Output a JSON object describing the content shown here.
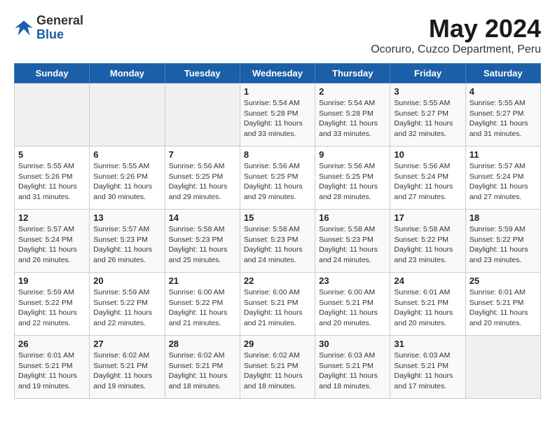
{
  "header": {
    "logo_general": "General",
    "logo_blue": "Blue",
    "title": "May 2024",
    "subtitle": "Ocoruro, Cuzco Department, Peru"
  },
  "days_of_week": [
    "Sunday",
    "Monday",
    "Tuesday",
    "Wednesday",
    "Thursday",
    "Friday",
    "Saturday"
  ],
  "weeks": [
    [
      {
        "day": "",
        "info": ""
      },
      {
        "day": "",
        "info": ""
      },
      {
        "day": "",
        "info": ""
      },
      {
        "day": "1",
        "info": "Sunrise: 5:54 AM\nSunset: 5:28 PM\nDaylight: 11 hours\nand 33 minutes."
      },
      {
        "day": "2",
        "info": "Sunrise: 5:54 AM\nSunset: 5:28 PM\nDaylight: 11 hours\nand 33 minutes."
      },
      {
        "day": "3",
        "info": "Sunrise: 5:55 AM\nSunset: 5:27 PM\nDaylight: 11 hours\nand 32 minutes."
      },
      {
        "day": "4",
        "info": "Sunrise: 5:55 AM\nSunset: 5:27 PM\nDaylight: 11 hours\nand 31 minutes."
      }
    ],
    [
      {
        "day": "5",
        "info": "Sunrise: 5:55 AM\nSunset: 5:26 PM\nDaylight: 11 hours\nand 31 minutes."
      },
      {
        "day": "6",
        "info": "Sunrise: 5:55 AM\nSunset: 5:26 PM\nDaylight: 11 hours\nand 30 minutes."
      },
      {
        "day": "7",
        "info": "Sunrise: 5:56 AM\nSunset: 5:25 PM\nDaylight: 11 hours\nand 29 minutes."
      },
      {
        "day": "8",
        "info": "Sunrise: 5:56 AM\nSunset: 5:25 PM\nDaylight: 11 hours\nand 29 minutes."
      },
      {
        "day": "9",
        "info": "Sunrise: 5:56 AM\nSunset: 5:25 PM\nDaylight: 11 hours\nand 28 minutes."
      },
      {
        "day": "10",
        "info": "Sunrise: 5:56 AM\nSunset: 5:24 PM\nDaylight: 11 hours\nand 27 minutes."
      },
      {
        "day": "11",
        "info": "Sunrise: 5:57 AM\nSunset: 5:24 PM\nDaylight: 11 hours\nand 27 minutes."
      }
    ],
    [
      {
        "day": "12",
        "info": "Sunrise: 5:57 AM\nSunset: 5:24 PM\nDaylight: 11 hours\nand 26 minutes."
      },
      {
        "day": "13",
        "info": "Sunrise: 5:57 AM\nSunset: 5:23 PM\nDaylight: 11 hours\nand 26 minutes."
      },
      {
        "day": "14",
        "info": "Sunrise: 5:58 AM\nSunset: 5:23 PM\nDaylight: 11 hours\nand 25 minutes."
      },
      {
        "day": "15",
        "info": "Sunrise: 5:58 AM\nSunset: 5:23 PM\nDaylight: 11 hours\nand 24 minutes."
      },
      {
        "day": "16",
        "info": "Sunrise: 5:58 AM\nSunset: 5:23 PM\nDaylight: 11 hours\nand 24 minutes."
      },
      {
        "day": "17",
        "info": "Sunrise: 5:58 AM\nSunset: 5:22 PM\nDaylight: 11 hours\nand 23 minutes."
      },
      {
        "day": "18",
        "info": "Sunrise: 5:59 AM\nSunset: 5:22 PM\nDaylight: 11 hours\nand 23 minutes."
      }
    ],
    [
      {
        "day": "19",
        "info": "Sunrise: 5:59 AM\nSunset: 5:22 PM\nDaylight: 11 hours\nand 22 minutes."
      },
      {
        "day": "20",
        "info": "Sunrise: 5:59 AM\nSunset: 5:22 PM\nDaylight: 11 hours\nand 22 minutes."
      },
      {
        "day": "21",
        "info": "Sunrise: 6:00 AM\nSunset: 5:22 PM\nDaylight: 11 hours\nand 21 minutes."
      },
      {
        "day": "22",
        "info": "Sunrise: 6:00 AM\nSunset: 5:21 PM\nDaylight: 11 hours\nand 21 minutes."
      },
      {
        "day": "23",
        "info": "Sunrise: 6:00 AM\nSunset: 5:21 PM\nDaylight: 11 hours\nand 20 minutes."
      },
      {
        "day": "24",
        "info": "Sunrise: 6:01 AM\nSunset: 5:21 PM\nDaylight: 11 hours\nand 20 minutes."
      },
      {
        "day": "25",
        "info": "Sunrise: 6:01 AM\nSunset: 5:21 PM\nDaylight: 11 hours\nand 20 minutes."
      }
    ],
    [
      {
        "day": "26",
        "info": "Sunrise: 6:01 AM\nSunset: 5:21 PM\nDaylight: 11 hours\nand 19 minutes."
      },
      {
        "day": "27",
        "info": "Sunrise: 6:02 AM\nSunset: 5:21 PM\nDaylight: 11 hours\nand 19 minutes."
      },
      {
        "day": "28",
        "info": "Sunrise: 6:02 AM\nSunset: 5:21 PM\nDaylight: 11 hours\nand 18 minutes."
      },
      {
        "day": "29",
        "info": "Sunrise: 6:02 AM\nSunset: 5:21 PM\nDaylight: 11 hours\nand 18 minutes."
      },
      {
        "day": "30",
        "info": "Sunrise: 6:03 AM\nSunset: 5:21 PM\nDaylight: 11 hours\nand 18 minutes."
      },
      {
        "day": "31",
        "info": "Sunrise: 6:03 AM\nSunset: 5:21 PM\nDaylight: 11 hours\nand 17 minutes."
      },
      {
        "day": "",
        "info": ""
      }
    ]
  ]
}
